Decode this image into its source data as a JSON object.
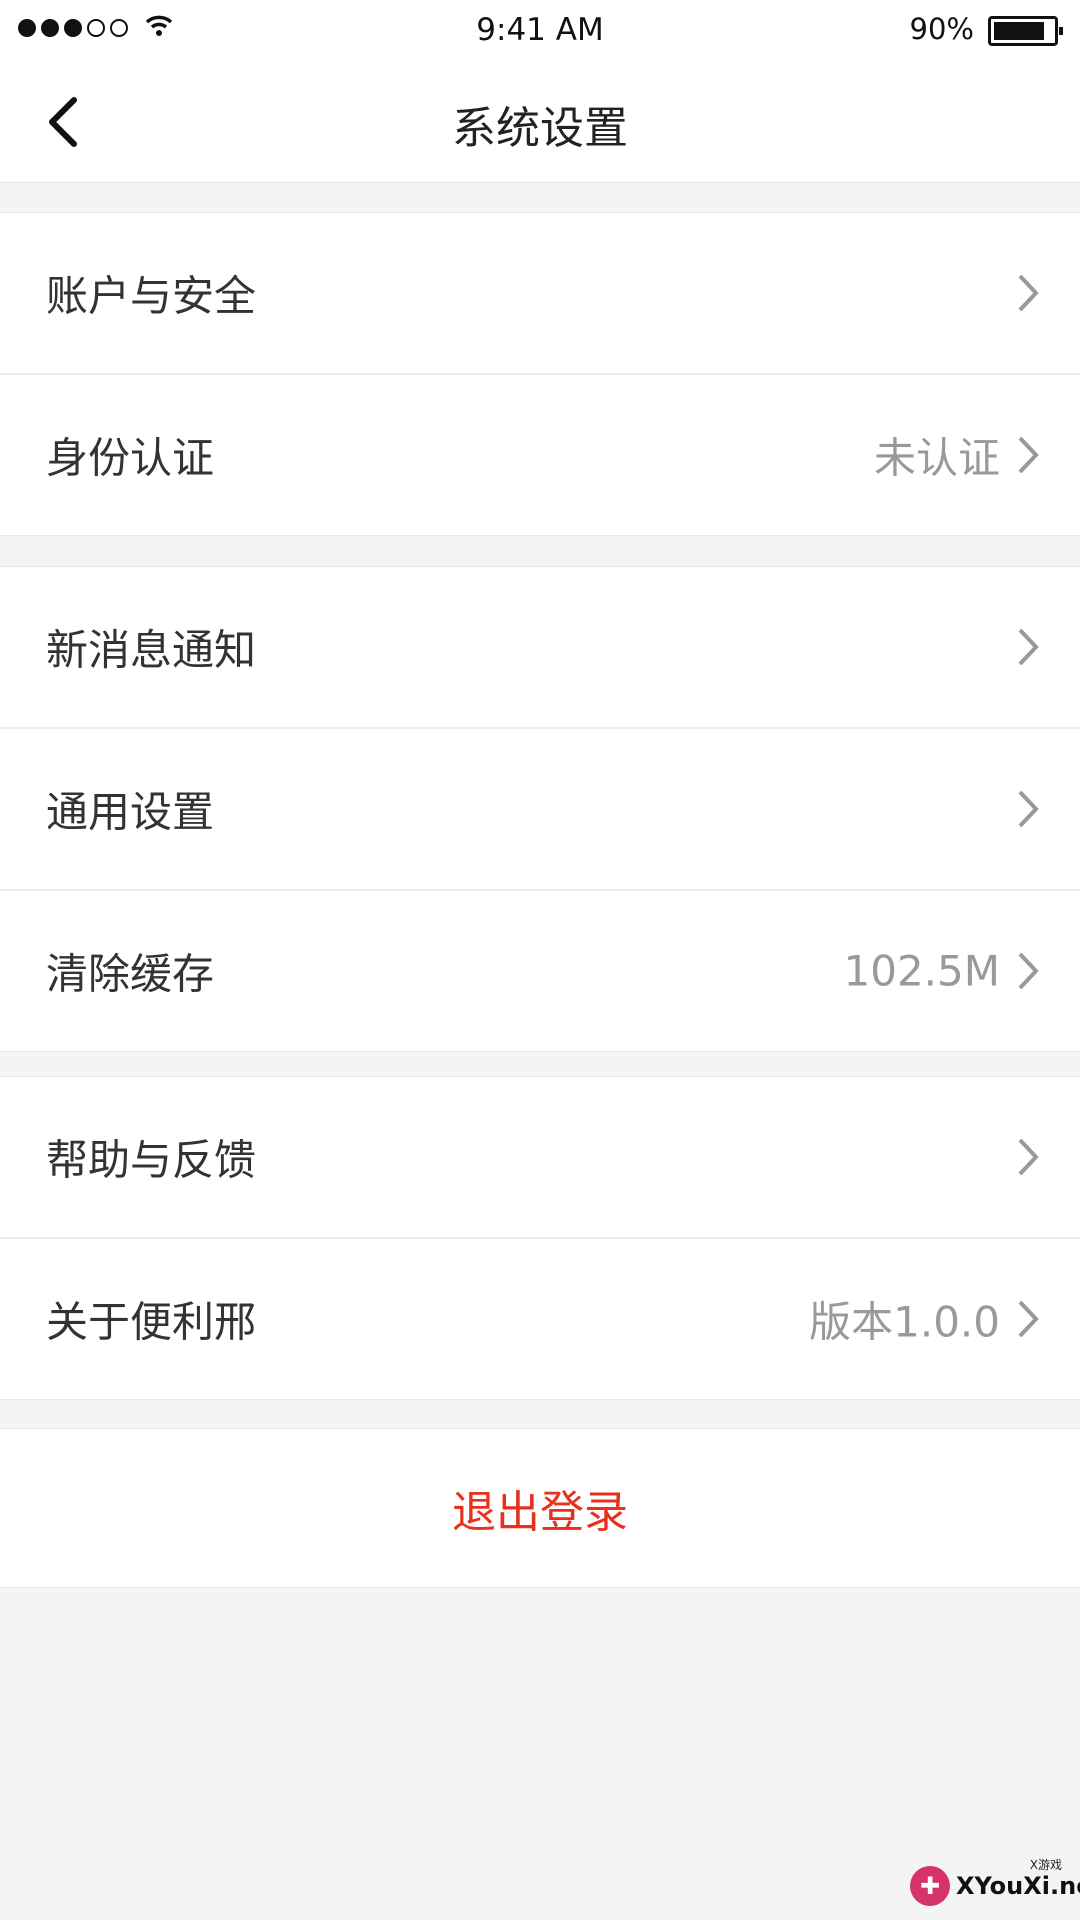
{
  "status_bar": {
    "time": "9:41 AM",
    "battery": "90%"
  },
  "nav": {
    "title": "系统设置"
  },
  "groups": [
    {
      "rows": [
        {
          "label": "账户与安全",
          "value": ""
        },
        {
          "label": "身份认证",
          "value": "未认证"
        }
      ]
    },
    {
      "rows": [
        {
          "label": "新消息通知",
          "value": ""
        },
        {
          "label": "通用设置",
          "value": ""
        },
        {
          "label": "清除缓存",
          "value": "102.5M"
        }
      ]
    },
    {
      "rows": [
        {
          "label": "帮助与反馈",
          "value": ""
        },
        {
          "label": "关于便利邢",
          "value": "版本1.0.0"
        }
      ]
    }
  ],
  "logout": {
    "label": "退出登录",
    "color": "#e8301c"
  },
  "watermark": {
    "text": "XYouXi.net",
    "small": "X游戏"
  },
  "colors": {
    "background": "#f4f4f6",
    "value_text": "#999999",
    "label_text": "#333333"
  }
}
